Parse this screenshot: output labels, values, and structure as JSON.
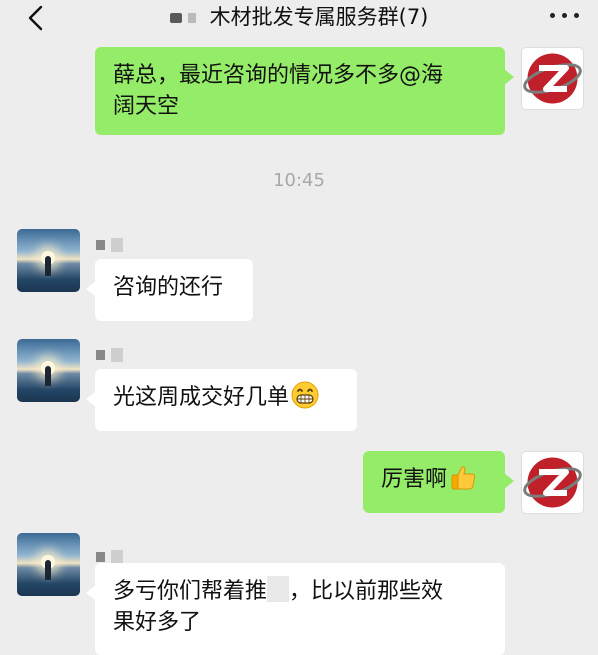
{
  "header": {
    "title": "木材批发专属服务群(7)"
  },
  "time_divider": "10:45",
  "messages": [
    {
      "side": "right",
      "text_1": "薛总，最近咨询的情况多不多@海",
      "text_2": "阔天空"
    },
    {
      "side": "left",
      "text": "咨询的还行"
    },
    {
      "side": "left",
      "text": "光这周成交好几单",
      "emoji": "grin-emoji"
    },
    {
      "side": "right",
      "text": "厉害啊",
      "emoji": "thumbs-up-emoji"
    },
    {
      "side": "left",
      "text_1a": "多亏你们帮着推",
      "text_1b": "，比以前那些效",
      "text_2": "果好多了"
    }
  ],
  "colors": {
    "background": "#ededed",
    "sent_bubble": "#95ec69",
    "received_bubble": "#ffffff",
    "brand_red": "#c0202a"
  },
  "icons": [
    "back-chevron-icon",
    "more-dots-icon"
  ]
}
